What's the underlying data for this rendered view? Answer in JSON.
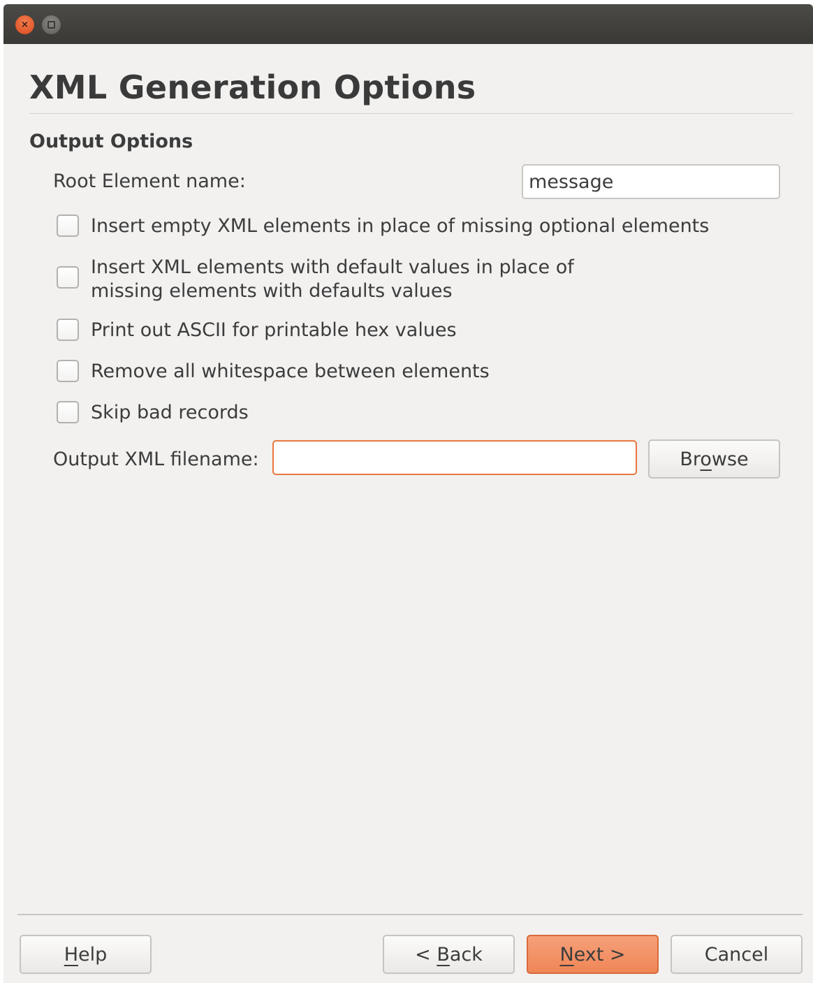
{
  "titlebar": {
    "close_glyph": "×",
    "buttons": [
      "close-icon",
      "maximize-icon"
    ]
  },
  "page": {
    "title": "XML Generation Options",
    "section_title": "Output Options"
  },
  "root_element": {
    "label": "Root Element name:",
    "value": "message"
  },
  "options": [
    {
      "label": "Insert empty XML elements in place of missing optional elements",
      "checked": false
    },
    {
      "label": "Insert XML elements with default values in place of\n missing elements with defaults values",
      "checked": false
    },
    {
      "label": "Print out ASCII for printable hex values",
      "checked": false
    },
    {
      "label": "Remove all whitespace between elements",
      "checked": false
    },
    {
      "label": "Skip bad records",
      "checked": false
    }
  ],
  "output_file": {
    "label": "Output XML filename:",
    "value": "",
    "browse_pre": "Br",
    "browse_mnemonic": "o",
    "browse_post": "wse"
  },
  "footer": {
    "help_mnemonic": "H",
    "help_rest": "elp",
    "back_pre": "< ",
    "back_mnemonic": "B",
    "back_rest": "ack",
    "next_mnemonic": "N",
    "next_rest": "ext >",
    "cancel": "Cancel"
  },
  "colors": {
    "accent": "#e9773f",
    "primary_button": "#f29168",
    "background": "#f2f1f0"
  }
}
